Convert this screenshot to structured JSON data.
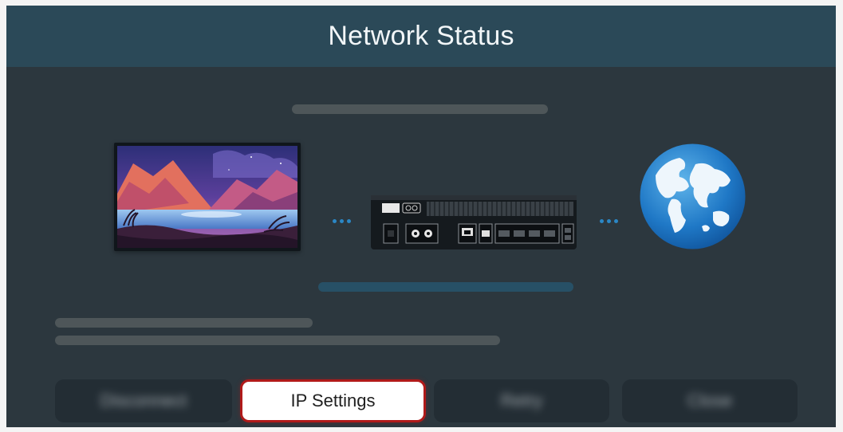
{
  "header": {
    "title": "Network Status"
  },
  "diagram": {
    "devices": [
      {
        "name": "TV",
        "icon": "tv-icon"
      },
      {
        "name": "Router",
        "icon": "router-icon"
      },
      {
        "name": "Internet",
        "icon": "globe-icon"
      }
    ]
  },
  "buttons": {
    "disconnect_label": "Disconnect",
    "ip_settings_label": "IP Settings",
    "retry_label": "Retry",
    "close_label": "Close",
    "focused": "IP Settings"
  },
  "colors": {
    "header_bg": "#2b4958",
    "panel_bg": "#2c373e",
    "focus_border": "#b01a1a",
    "dot_blue": "#2b87c5"
  }
}
